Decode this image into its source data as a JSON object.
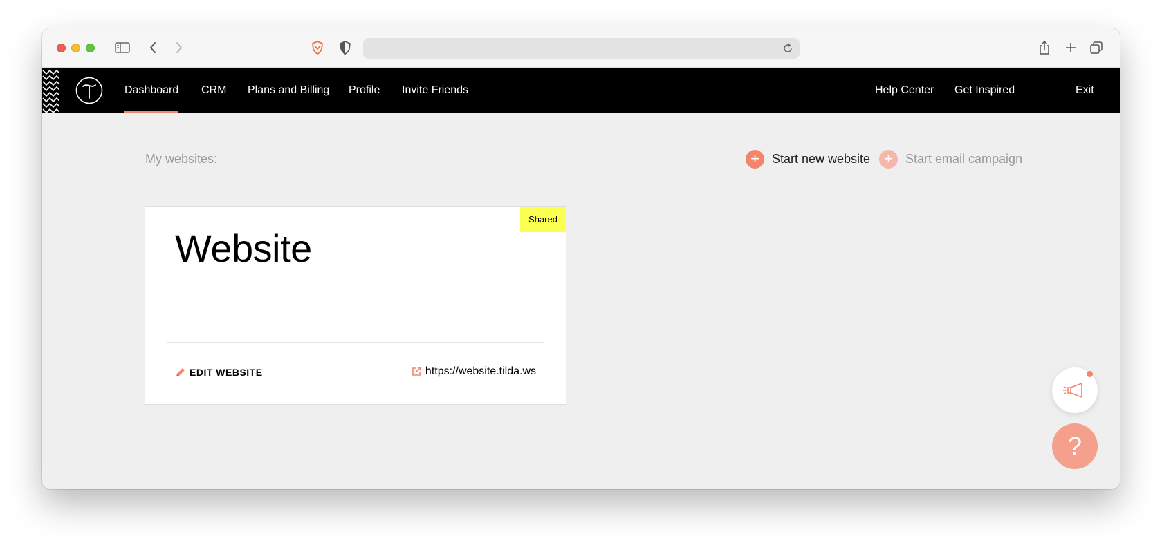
{
  "nav": {
    "items": [
      {
        "label": "Dashboard"
      },
      {
        "label": "CRM"
      },
      {
        "label": "Plans and Billing"
      },
      {
        "label": "Profile"
      },
      {
        "label": "Invite Friends"
      }
    ],
    "right": [
      {
        "label": "Help Center"
      },
      {
        "label": "Get Inspired"
      },
      {
        "label": "Exit"
      }
    ]
  },
  "dashboard": {
    "section_label": "My websites:",
    "start_website_label": "Start new website",
    "start_email_label": "Start email campaign"
  },
  "card": {
    "title": "Website",
    "badge": "Shared",
    "edit_label": "EDIT WEBSITE",
    "url": "https://website.tilda.ws"
  },
  "help": {
    "glyph": "?"
  },
  "colors": {
    "accent": "#f4846b",
    "accent_light": "#f4b8aa",
    "badge": "#fbff51",
    "nav_bg": "#000000",
    "page_bg": "#efefef"
  }
}
